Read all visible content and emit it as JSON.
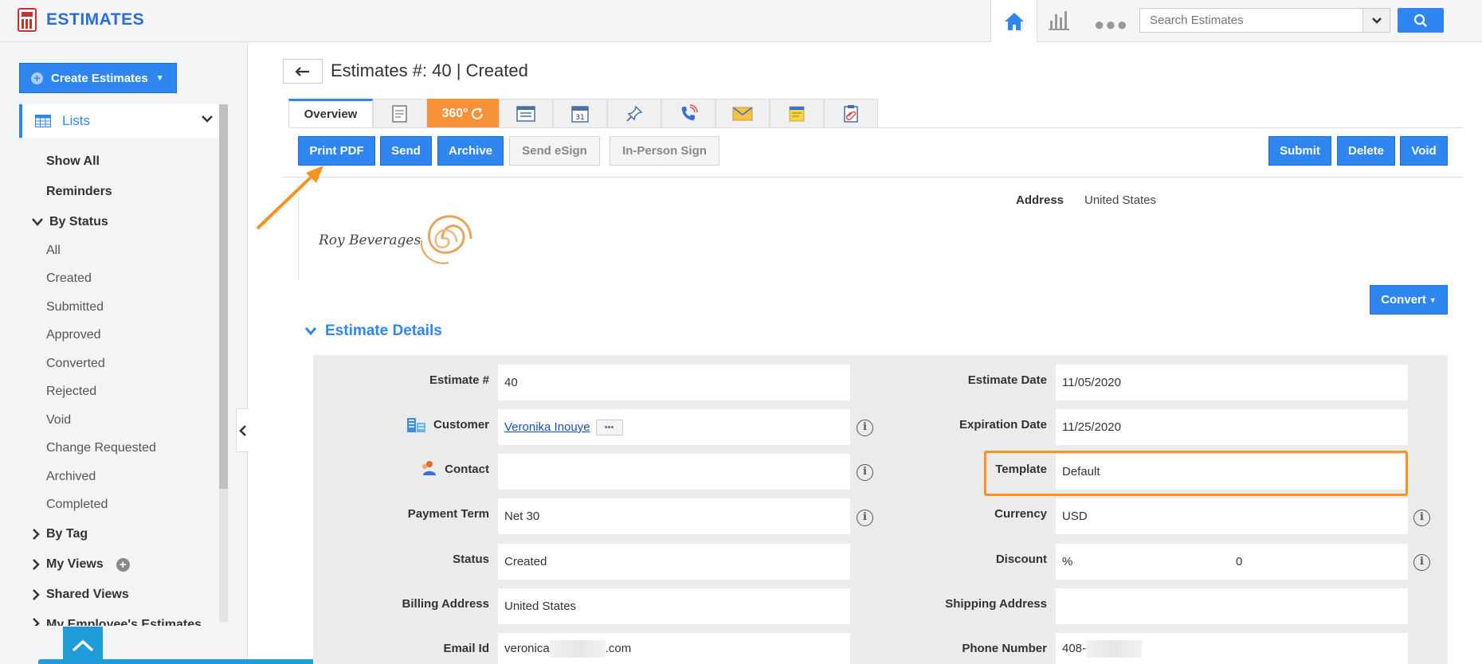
{
  "app": {
    "name": "ESTIMATES"
  },
  "search": {
    "placeholder": "Search Estimates"
  },
  "sidebar": {
    "create_button": "Create Estimates",
    "lists_label": "Lists",
    "items": {
      "show_all": "Show All",
      "reminders": "Reminders",
      "by_status": "By Status",
      "statuses": [
        "All",
        "Created",
        "Submitted",
        "Approved",
        "Converted",
        "Rejected",
        "Void",
        "Change Requested",
        "Archived",
        "Completed"
      ],
      "by_tag": "By Tag",
      "my_views": "My Views",
      "shared_views": "Shared Views",
      "my_employees": "My Employee's Estimates"
    }
  },
  "page": {
    "title": "Estimates #: 40 | Created"
  },
  "tabs": {
    "overview": "Overview",
    "three60": "360°"
  },
  "actions": {
    "print_pdf": "Print PDF",
    "send": "Send",
    "archive": "Archive",
    "send_esign": "Send eSign",
    "in_person_sign": "In-Person Sign",
    "submit": "Submit",
    "delete": "Delete",
    "void": "Void"
  },
  "header_info": {
    "logo_text": "Roy Beverages",
    "address_label": "Address",
    "address_value": "United States"
  },
  "convert_button": "Convert",
  "section": {
    "title": "Estimate Details"
  },
  "fields": {
    "estimate_no": {
      "label": "Estimate #",
      "value": "40"
    },
    "customer": {
      "label": "Customer",
      "value": "Veronika Inouye"
    },
    "contact": {
      "label": "Contact",
      "value": ""
    },
    "payment_term": {
      "label": "Payment Term",
      "value": "Net 30"
    },
    "status": {
      "label": "Status",
      "value": "Created"
    },
    "billing_address": {
      "label": "Billing Address",
      "value": "United States"
    },
    "email": {
      "label": "Email Id",
      "value_prefix": "veronica",
      "value_suffix": ".com"
    },
    "estimate_date": {
      "label": "Estimate Date",
      "value": "11/05/2020"
    },
    "expiration_date": {
      "label": "Expiration Date",
      "value": "11/25/2020"
    },
    "template": {
      "label": "Template",
      "value": "Default"
    },
    "currency": {
      "label": "Currency",
      "value": "USD"
    },
    "discount": {
      "label": "Discount",
      "unit": "%",
      "value": "0"
    },
    "shipping_address": {
      "label": "Shipping Address",
      "value": ""
    },
    "phone": {
      "label": "Phone Number",
      "value_prefix": "408-"
    }
  },
  "colors": {
    "primary": "#2f86f0",
    "accent_orange": "#f7931e",
    "tab_orange": "#f7923a"
  }
}
